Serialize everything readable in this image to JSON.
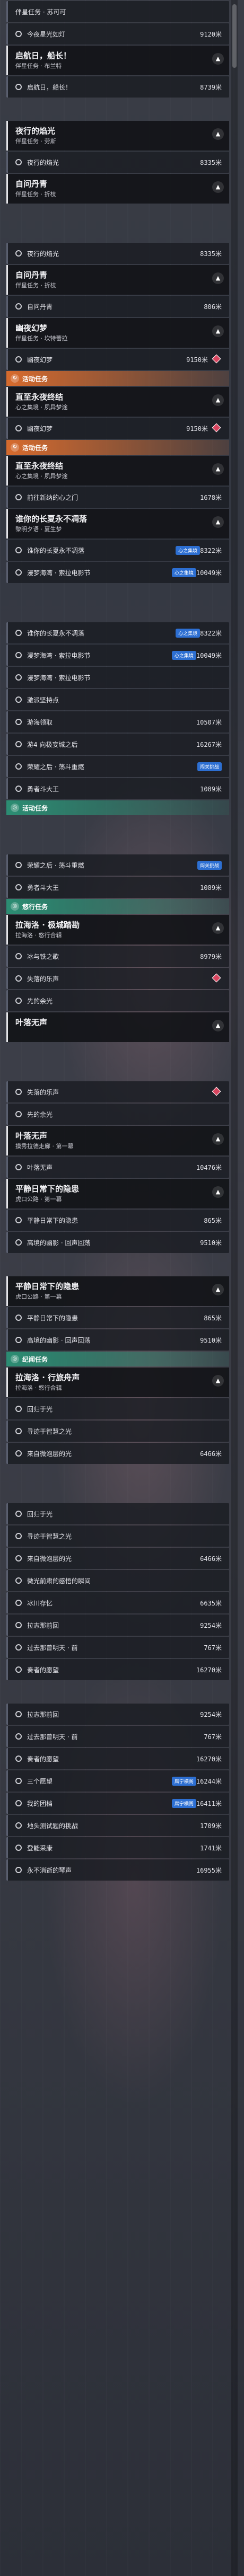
{
  "list": [
    {
      "kind": "item",
      "label": "伴星任务 · 苏可可",
      "dist": "",
      "bullet": false
    },
    {
      "kind": "item",
      "label": "今夜星光如灯",
      "dist": "9120米"
    },
    {
      "kind": "quest",
      "title": "启航日，船长！",
      "sub": "伴星任务 · 布兰特"
    },
    {
      "kind": "item",
      "label": "启航日，船长！",
      "dist": "8739米"
    },
    {
      "kind": "spacer"
    },
    {
      "kind": "quest",
      "title": "夜行的焰光",
      "sub": "伴星任务 · 劳斯"
    },
    {
      "kind": "item",
      "label": "夜行的焰光",
      "dist": "8335米"
    },
    {
      "kind": "quest",
      "title": "自问丹青",
      "sub": "伴星任务 · 折枝"
    },
    {
      "kind": "spacer-l"
    },
    {
      "kind": "item",
      "label": "夜行的焰光",
      "dist": "8335米"
    },
    {
      "kind": "quest",
      "title": "自问丹青",
      "sub": "伴星任务 · 折枝"
    },
    {
      "kind": "item",
      "label": "自问丹青",
      "dist": "806米"
    },
    {
      "kind": "quest",
      "title": "幽夜幻梦",
      "sub": "伴星任务 · 坎特蕾拉"
    },
    {
      "kind": "item",
      "label": "幽夜幻梦",
      "dist": "9150米",
      "diamond": true
    },
    {
      "kind": "section",
      "tone": "orange",
      "label": "活动任务",
      "icon": "↻"
    },
    {
      "kind": "quest",
      "title": "直至永夜终结",
      "sub": "心之集境 · 夙异梦途"
    },
    {
      "kind": "item",
      "label": "幽夜幻梦",
      "dist": "9150米",
      "diamond": true
    },
    {
      "kind": "section",
      "tone": "orange",
      "label": "活动任务",
      "icon": "↻"
    },
    {
      "kind": "quest",
      "title": "直至永夜终结",
      "sub": "心之集境 · 夙异梦途"
    },
    {
      "kind": "item",
      "label": "前往新纳的心之门",
      "dist": "1678米"
    },
    {
      "kind": "quest",
      "title": "谁你的长夏永不凋落",
      "sub": "黎明夕语 · 夏生梦"
    },
    {
      "kind": "item",
      "label": "谁你的长夏永不凋落",
      "dist": "8322米",
      "chip": "心之集境"
    },
    {
      "kind": "item",
      "label": "漫梦海湾 · 索拉电影节",
      "dist": "10049米",
      "chip": "心之集境"
    },
    {
      "kind": "spacer-l"
    },
    {
      "kind": "item",
      "label": "谁你的长夏永不凋落",
      "dist": "8322米",
      "chip": "心之集境"
    },
    {
      "kind": "item",
      "label": "漫梦海湾 · 索拉电影节",
      "dist": "10049米",
      "chip": "心之集境"
    },
    {
      "kind": "item",
      "label": "漫梦海湾 · 索拉电影节",
      "dist": ""
    },
    {
      "kind": "item",
      "label": "激派坚持点",
      "dist": ""
    },
    {
      "kind": "item",
      "label": "游海领取",
      "dist": "10507米"
    },
    {
      "kind": "item",
      "label": "游4 向极妄城之后",
      "dist": "16267米"
    },
    {
      "kind": "item",
      "label": "荣耀之后 · 荡斗重燃",
      "dist": "",
      "chip": "闯关挑战"
    },
    {
      "kind": "item",
      "label": "勇者斗大王",
      "dist": "1089米"
    },
    {
      "kind": "section",
      "tone": "green",
      "label": "活动任务",
      "icon": "◎"
    },
    {
      "kind": "spacer-l"
    },
    {
      "kind": "item",
      "label": "荣耀之后 · 荡斗重燃",
      "dist": "",
      "chip": "闯关挑战"
    },
    {
      "kind": "item",
      "label": "勇者斗大王",
      "dist": "1089米"
    },
    {
      "kind": "section",
      "tone": "green",
      "label": "悠行任务",
      "icon": "◎"
    },
    {
      "kind": "quest",
      "title": "拉海洛 · 极城踏勘",
      "sub": "拉海洛 · 悠行合辑"
    },
    {
      "kind": "item",
      "label": "冰与铁之歌",
      "dist": "8979米"
    },
    {
      "kind": "item",
      "label": "失落的乐声",
      "dist": "",
      "diamond": true
    },
    {
      "kind": "item",
      "label": "先的余光",
      "dist": ""
    },
    {
      "kind": "quest",
      "title": "叶落无声",
      "sub": ""
    },
    {
      "kind": "spacer-l"
    },
    {
      "kind": "item",
      "label": "失落的乐声",
      "dist": "",
      "diamond": true
    },
    {
      "kind": "item",
      "label": "先的余光",
      "dist": ""
    },
    {
      "kind": "quest",
      "title": "叶落无声",
      "sub": "摸秀拉德走廊 · 第一幕"
    },
    {
      "kind": "item",
      "label": "叶落无声",
      "dist": "10476米"
    },
    {
      "kind": "quest",
      "title": "平静日常下的隐患",
      "sub": "虎口公路 · 第一幕"
    },
    {
      "kind": "item",
      "label": "平静日常下的隐患",
      "dist": "865米"
    },
    {
      "kind": "item",
      "label": "高境的幽影 · 回声回荡",
      "dist": "9510米"
    },
    {
      "kind": "spacer"
    },
    {
      "kind": "quest",
      "title": "平静日常下的隐患",
      "sub": "虎口公路 · 第一幕"
    },
    {
      "kind": "item",
      "label": "平静日常下的隐患",
      "dist": "865米"
    },
    {
      "kind": "item",
      "label": "高境的幽影 · 回声回荡",
      "dist": "9510米"
    },
    {
      "kind": "section",
      "tone": "green",
      "label": "纪闻任务",
      "icon": "◎"
    },
    {
      "kind": "quest",
      "title": "拉海洛 · 行旅舟声",
      "sub": "拉海洛 · 悠行合辑"
    },
    {
      "kind": "item",
      "label": "回归于光",
      "dist": ""
    },
    {
      "kind": "item",
      "label": "寻迹于智慧之光",
      "dist": ""
    },
    {
      "kind": "item",
      "label": "来自微泡层的光",
      "dist": "6466米"
    },
    {
      "kind": "spacer-l"
    },
    {
      "kind": "item",
      "label": "回归于光",
      "dist": ""
    },
    {
      "kind": "item",
      "label": "寻迹于智慧之光",
      "dist": ""
    },
    {
      "kind": "item",
      "label": "来自微泡层的光",
      "dist": "6466米"
    },
    {
      "kind": "item",
      "label": "微光前肃的感悟的瞬间",
      "dist": ""
    },
    {
      "kind": "item",
      "label": "冰川存忆",
      "dist": "6635米"
    },
    {
      "kind": "item",
      "label": "拉志那前回",
      "dist": "9254米"
    },
    {
      "kind": "item",
      "label": "过去那曾明天 · 前",
      "dist": "767米"
    },
    {
      "kind": "item",
      "label": "奏者的愿望",
      "dist": "16270米"
    },
    {
      "kind": "spacer"
    },
    {
      "kind": "item",
      "label": "拉志那前回",
      "dist": "9254米"
    },
    {
      "kind": "item",
      "label": "过去那曾明天 · 前",
      "dist": "767米"
    },
    {
      "kind": "item",
      "label": "奏者的愿望",
      "dist": "16270米"
    },
    {
      "kind": "item",
      "label": "三个愿望",
      "dist": "16244米",
      "chip": "腐宁横阁"
    },
    {
      "kind": "item",
      "label": "我的团档",
      "dist": "16411米",
      "chip": "腐宁横阁"
    },
    {
      "kind": "item",
      "label": "地头测试题的挑战",
      "dist": "1709米"
    },
    {
      "kind": "item",
      "label": "登能采康",
      "dist": "1741米"
    },
    {
      "kind": "item",
      "label": "永不消逝的琴声",
      "dist": "16955米"
    }
  ]
}
